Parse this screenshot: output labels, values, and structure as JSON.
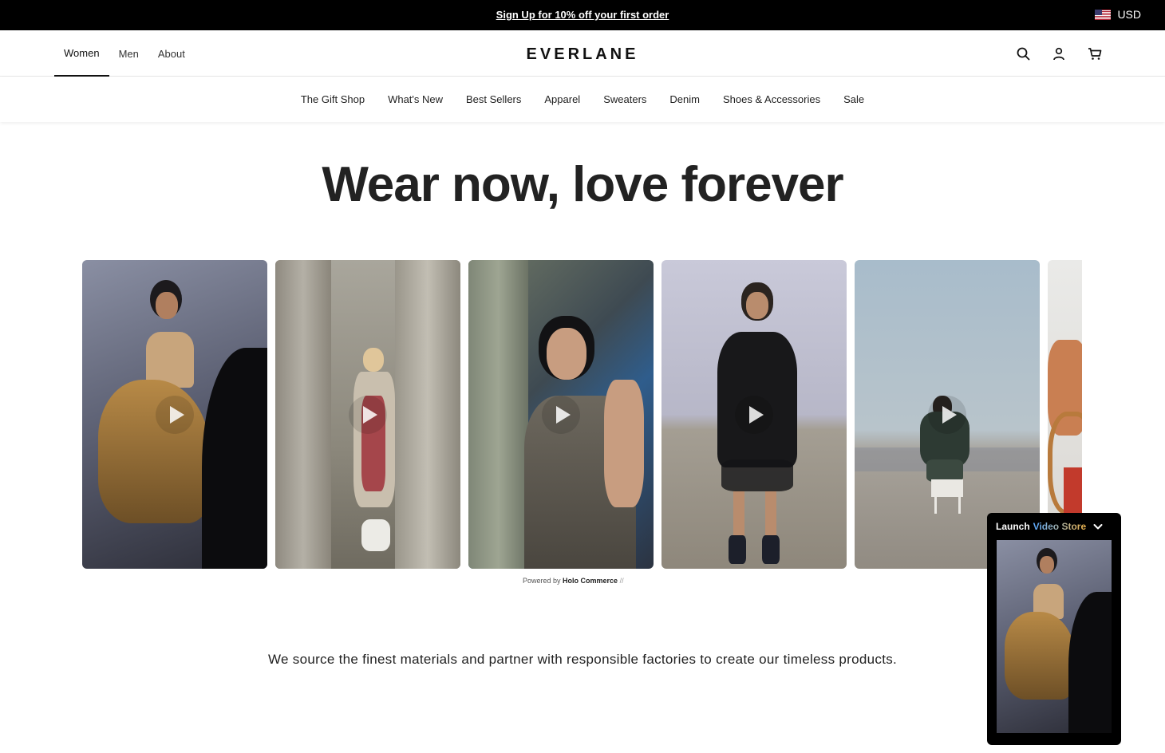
{
  "promo": {
    "text": "Sign Up for 10% off your first order",
    "currency": "USD",
    "flag_icon": "us-flag-icon"
  },
  "header": {
    "logo": "EVERLANE",
    "nav": [
      "Women",
      "Men",
      "About"
    ],
    "active_nav": "Women",
    "icons": [
      "search-icon",
      "account-icon",
      "cart-icon"
    ]
  },
  "categories": [
    "The Gift Shop",
    "What's New",
    "Best Sellers",
    "Apparel",
    "Sweaters",
    "Denim",
    "Shoes & Accessories",
    "Sale"
  ],
  "hero": {
    "title": "Wear now, love forever"
  },
  "carousel": {
    "items": [
      {
        "name": "video-card-1",
        "icon": "play-icon"
      },
      {
        "name": "video-card-2",
        "icon": "play-icon"
      },
      {
        "name": "video-card-3",
        "icon": "play-icon"
      },
      {
        "name": "video-card-4",
        "icon": "play-icon"
      },
      {
        "name": "video-card-5",
        "icon": "play-icon"
      },
      {
        "name": "video-card-6",
        "icon": "play-icon"
      }
    ],
    "powered_prefix": "Powered by",
    "powered_brand": "Holo Commerce",
    "powered_suffix": "//"
  },
  "tagline": "We source the finest materials and partner with responsible factories to create our timeless products.",
  "widget": {
    "launch": "Launch",
    "accent": "Video Store",
    "icon": "chevron-down-icon"
  },
  "colors": {
    "promo_bg": "#000000",
    "text": "#1a1a1a",
    "widget_accent_start": "#5aa9ff",
    "widget_accent_end": "#f0b44a"
  }
}
